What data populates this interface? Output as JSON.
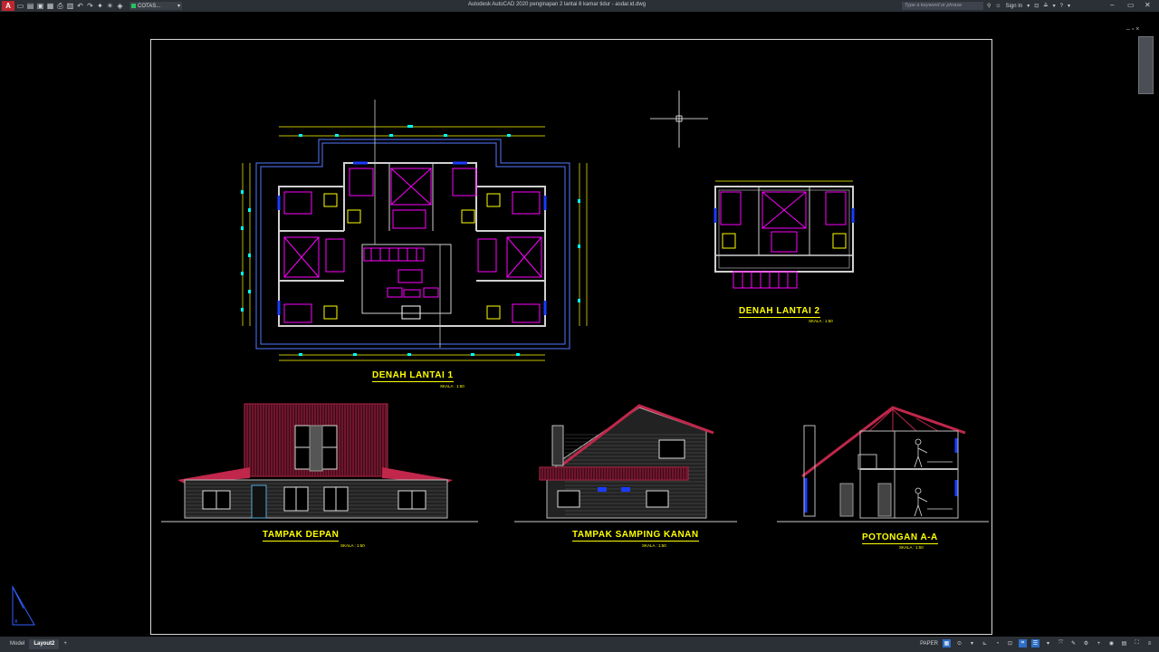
{
  "app": {
    "logo": "A",
    "title": "Autodesk AutoCAD 2020   penginapan 2 lantai 8 kamar tidur - asdar.id.dwg",
    "layer_name": "COTAS...",
    "search_placeholder": "Type a keyword or phrase",
    "sign_in": "Sign In",
    "qat_icons": [
      "new-icon",
      "open-icon",
      "save-icon",
      "saveas-icon",
      "print-icon",
      "plot-icon",
      "undo-icon",
      "redo-icon",
      "light-icon",
      "sun-icon",
      "layer-icon"
    ]
  },
  "drawings": {
    "plan1": {
      "title": "DENAH LANTAI 1",
      "scale": "SKALA : 1:50"
    },
    "plan2": {
      "title": "DENAH LANTAI 2",
      "scale": "SKALA : 1:50"
    },
    "front": {
      "title": "TAMPAK DEPAN",
      "scale": "SKALA : 1:50"
    },
    "side": {
      "title": "TAMPAK SAMPING KANAN",
      "scale": "SKALA : 1:50"
    },
    "section": {
      "title": "POTONGAN A-A",
      "scale": "SKALA : 1:50"
    }
  },
  "tabs": [
    {
      "label": "Model"
    },
    {
      "label": "Layout2"
    },
    {
      "label": "+"
    }
  ],
  "status": {
    "mode": "PAPER"
  },
  "colors": {
    "cad_magenta": "#ff00ff",
    "cad_cyan": "#00ffff",
    "cad_yellow": "#ffff00",
    "cad_blue": "#1a3cff",
    "cad_roof": "#c0274b",
    "ui_bg": "#2b2f36"
  }
}
